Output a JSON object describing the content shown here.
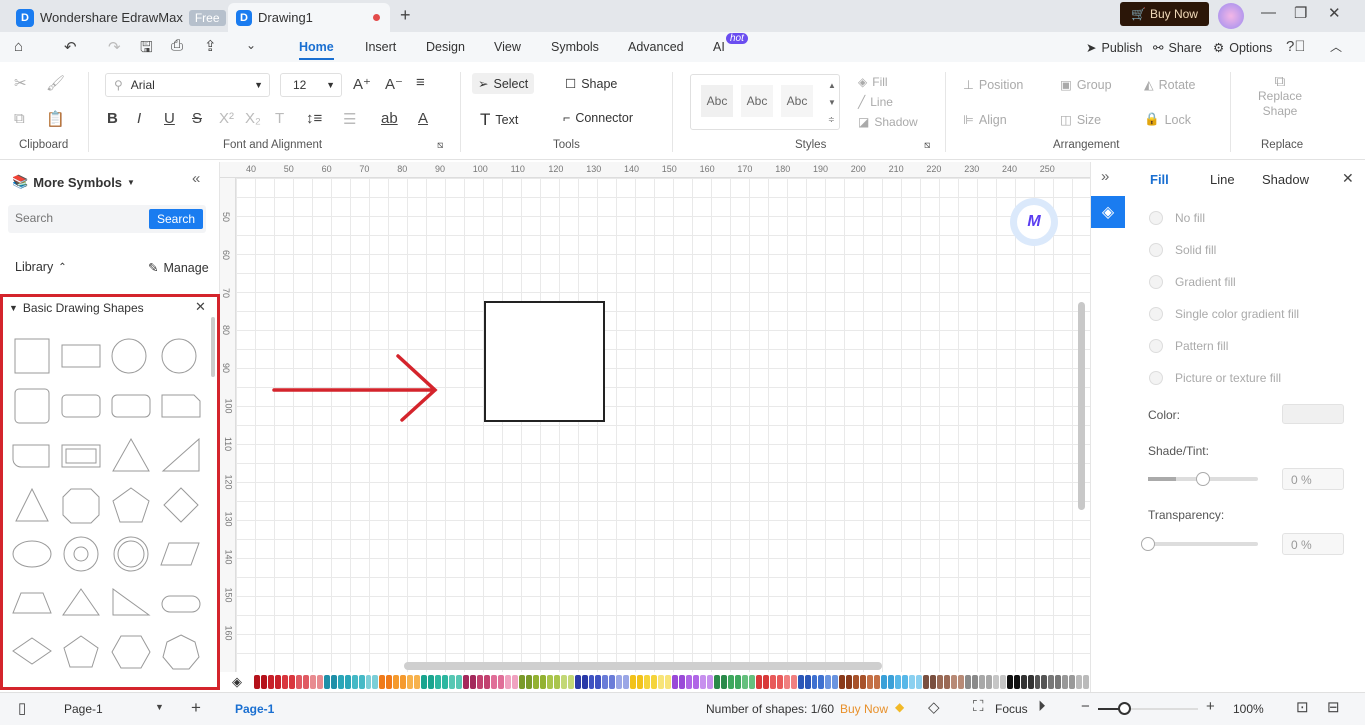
{
  "app": {
    "name": "Wondershare EdrawMax",
    "badge": "Free",
    "doc_tab": "Drawing1",
    "buy_now": "Buy Now"
  },
  "menu": {
    "tabs": [
      "Home",
      "Insert",
      "Design",
      "View",
      "Symbols",
      "Advanced",
      "AI"
    ],
    "ai_badge": "hot",
    "active": "Home",
    "publish": "Publish",
    "share": "Share",
    "options": "Options"
  },
  "ribbon": {
    "font": "Arial",
    "size": "12",
    "select": "Select",
    "shape": "Shape",
    "text": "Text",
    "connector": "Connector",
    "style_samples": [
      "Abc",
      "Abc",
      "Abc"
    ],
    "fill": "Fill",
    "line": "Line",
    "shadow": "Shadow",
    "position": "Position",
    "group": "Group",
    "rotate": "Rotate",
    "align": "Align",
    "size_label": "Size",
    "lock": "Lock",
    "replace_shape_1": "Replace",
    "replace_shape_2": "Shape",
    "groups": {
      "clipboard": "Clipboard",
      "font": "Font and Alignment",
      "tools": "Tools",
      "styles": "Styles",
      "arrangement": "Arrangement",
      "replace": "Replace"
    }
  },
  "left": {
    "title": "More Symbols",
    "search_placeholder": "Search",
    "search_btn": "Search",
    "library": "Library",
    "manage": "Manage",
    "section": "Basic Drawing Shapes"
  },
  "rulers": {
    "h": [
      "40",
      "50",
      "60",
      "70",
      "80",
      "90",
      "100",
      "110",
      "120",
      "130",
      "140",
      "150",
      "160",
      "170",
      "180",
      "190",
      "200",
      "210",
      "220",
      "230",
      "240",
      "250"
    ],
    "v": [
      "50",
      "60",
      "70",
      "80",
      "90",
      "100",
      "110",
      "120",
      "130",
      "140",
      "150",
      "160"
    ]
  },
  "right": {
    "tabs": [
      "Fill",
      "Line",
      "Shadow"
    ],
    "active": "Fill",
    "options": [
      "No fill",
      "Solid fill",
      "Gradient fill",
      "Single color gradient fill",
      "Pattern fill",
      "Picture or texture fill"
    ],
    "color_label": "Color:",
    "shade_label": "Shade/Tint:",
    "shade_value": "0 %",
    "transparency_label": "Transparency:",
    "transparency_value": "0 %",
    "shade_percent": 50,
    "transparency_percent": 0
  },
  "palette": [
    "#b5121b",
    "#c8202a",
    "#d9363e",
    "#e05a62",
    "#e88b90",
    "#1f8fa8",
    "#2aa6b8",
    "#45b9c6",
    "#7ccfd8",
    "#f07a1a",
    "#f59a2e",
    "#f7b24c",
    "#1aa58f",
    "#2db7a0",
    "#56c7b3",
    "#a42a5c",
    "#c2416f",
    "#e06e98",
    "#f0a2c0",
    "#7a9a2a",
    "#93b232",
    "#aac54c",
    "#c3d876",
    "#2a3aa8",
    "#3e52c2",
    "#6a7cd8",
    "#9aa6e6",
    "#f2c21a",
    "#f5d43a",
    "#f8e478",
    "#9a4ad8",
    "#b066e6",
    "#c790ee",
    "#2a8a4a",
    "#3ea85e",
    "#66c07e",
    "#d93a3a",
    "#e85a5a",
    "#f08080",
    "#2a56b8",
    "#3e70d0",
    "#6a94e0",
    "#8a3a1a",
    "#a8522a",
    "#c47046",
    "#3aa0d8",
    "#58b8e8",
    "#8ad0f0",
    "#7a5040",
    "#9a6a56",
    "#b88a76",
    "#8a8a8a",
    "#a8a8a8",
    "#c6c6c6",
    "#111111",
    "#333333",
    "#555555",
    "#777777",
    "#999999",
    "#bbbbbb"
  ],
  "status": {
    "page_selector": "Page-1",
    "page_tab": "Page-1",
    "shapes": "Number of shapes: 1/60",
    "buy_now": "Buy Now",
    "focus": "Focus",
    "zoom": "100%",
    "zoom_percent": 100
  }
}
